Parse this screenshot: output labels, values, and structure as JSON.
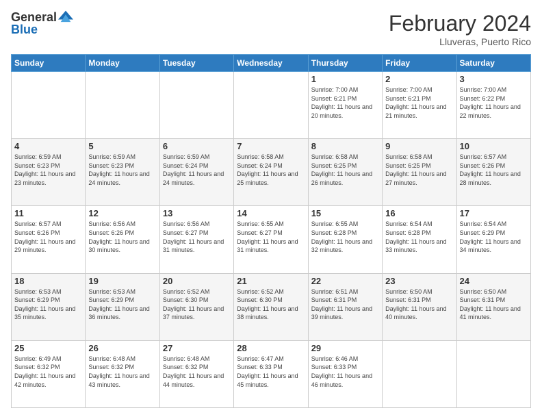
{
  "logo": {
    "general": "General",
    "blue": "Blue"
  },
  "header": {
    "month_year": "February 2024",
    "location": "Lluveras, Puerto Rico"
  },
  "days_of_week": [
    "Sunday",
    "Monday",
    "Tuesday",
    "Wednesday",
    "Thursday",
    "Friday",
    "Saturday"
  ],
  "weeks": [
    [
      {
        "day": "",
        "info": ""
      },
      {
        "day": "",
        "info": ""
      },
      {
        "day": "",
        "info": ""
      },
      {
        "day": "",
        "info": ""
      },
      {
        "day": "1",
        "info": "Sunrise: 7:00 AM\nSunset: 6:21 PM\nDaylight: 11 hours and 20 minutes."
      },
      {
        "day": "2",
        "info": "Sunrise: 7:00 AM\nSunset: 6:21 PM\nDaylight: 11 hours and 21 minutes."
      },
      {
        "day": "3",
        "info": "Sunrise: 7:00 AM\nSunset: 6:22 PM\nDaylight: 11 hours and 22 minutes."
      }
    ],
    [
      {
        "day": "4",
        "info": "Sunrise: 6:59 AM\nSunset: 6:23 PM\nDaylight: 11 hours and 23 minutes."
      },
      {
        "day": "5",
        "info": "Sunrise: 6:59 AM\nSunset: 6:23 PM\nDaylight: 11 hours and 24 minutes."
      },
      {
        "day": "6",
        "info": "Sunrise: 6:59 AM\nSunset: 6:24 PM\nDaylight: 11 hours and 24 minutes."
      },
      {
        "day": "7",
        "info": "Sunrise: 6:58 AM\nSunset: 6:24 PM\nDaylight: 11 hours and 25 minutes."
      },
      {
        "day": "8",
        "info": "Sunrise: 6:58 AM\nSunset: 6:25 PM\nDaylight: 11 hours and 26 minutes."
      },
      {
        "day": "9",
        "info": "Sunrise: 6:58 AM\nSunset: 6:25 PM\nDaylight: 11 hours and 27 minutes."
      },
      {
        "day": "10",
        "info": "Sunrise: 6:57 AM\nSunset: 6:26 PM\nDaylight: 11 hours and 28 minutes."
      }
    ],
    [
      {
        "day": "11",
        "info": "Sunrise: 6:57 AM\nSunset: 6:26 PM\nDaylight: 11 hours and 29 minutes."
      },
      {
        "day": "12",
        "info": "Sunrise: 6:56 AM\nSunset: 6:26 PM\nDaylight: 11 hours and 30 minutes."
      },
      {
        "day": "13",
        "info": "Sunrise: 6:56 AM\nSunset: 6:27 PM\nDaylight: 11 hours and 31 minutes."
      },
      {
        "day": "14",
        "info": "Sunrise: 6:55 AM\nSunset: 6:27 PM\nDaylight: 11 hours and 31 minutes."
      },
      {
        "day": "15",
        "info": "Sunrise: 6:55 AM\nSunset: 6:28 PM\nDaylight: 11 hours and 32 minutes."
      },
      {
        "day": "16",
        "info": "Sunrise: 6:54 AM\nSunset: 6:28 PM\nDaylight: 11 hours and 33 minutes."
      },
      {
        "day": "17",
        "info": "Sunrise: 6:54 AM\nSunset: 6:29 PM\nDaylight: 11 hours and 34 minutes."
      }
    ],
    [
      {
        "day": "18",
        "info": "Sunrise: 6:53 AM\nSunset: 6:29 PM\nDaylight: 11 hours and 35 minutes."
      },
      {
        "day": "19",
        "info": "Sunrise: 6:53 AM\nSunset: 6:29 PM\nDaylight: 11 hours and 36 minutes."
      },
      {
        "day": "20",
        "info": "Sunrise: 6:52 AM\nSunset: 6:30 PM\nDaylight: 11 hours and 37 minutes."
      },
      {
        "day": "21",
        "info": "Sunrise: 6:52 AM\nSunset: 6:30 PM\nDaylight: 11 hours and 38 minutes."
      },
      {
        "day": "22",
        "info": "Sunrise: 6:51 AM\nSunset: 6:31 PM\nDaylight: 11 hours and 39 minutes."
      },
      {
        "day": "23",
        "info": "Sunrise: 6:50 AM\nSunset: 6:31 PM\nDaylight: 11 hours and 40 minutes."
      },
      {
        "day": "24",
        "info": "Sunrise: 6:50 AM\nSunset: 6:31 PM\nDaylight: 11 hours and 41 minutes."
      }
    ],
    [
      {
        "day": "25",
        "info": "Sunrise: 6:49 AM\nSunset: 6:32 PM\nDaylight: 11 hours and 42 minutes."
      },
      {
        "day": "26",
        "info": "Sunrise: 6:48 AM\nSunset: 6:32 PM\nDaylight: 11 hours and 43 minutes."
      },
      {
        "day": "27",
        "info": "Sunrise: 6:48 AM\nSunset: 6:32 PM\nDaylight: 11 hours and 44 minutes."
      },
      {
        "day": "28",
        "info": "Sunrise: 6:47 AM\nSunset: 6:33 PM\nDaylight: 11 hours and 45 minutes."
      },
      {
        "day": "29",
        "info": "Sunrise: 6:46 AM\nSunset: 6:33 PM\nDaylight: 11 hours and 46 minutes."
      },
      {
        "day": "",
        "info": ""
      },
      {
        "day": "",
        "info": ""
      }
    ]
  ]
}
